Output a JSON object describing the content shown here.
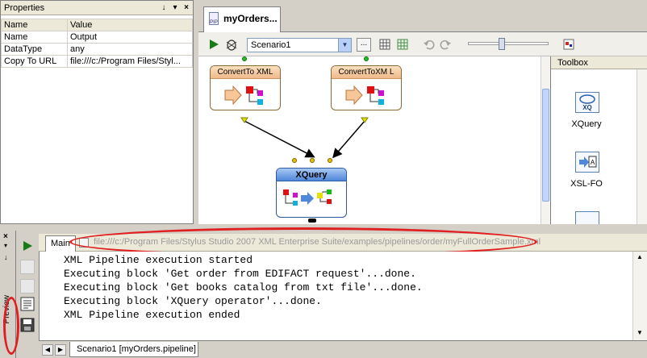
{
  "properties": {
    "title": "Properties",
    "columns": [
      "Name",
      "Value"
    ],
    "rows": [
      {
        "name": "Name",
        "value": "Output"
      },
      {
        "name": "DataType",
        "value": "any"
      },
      {
        "name": "Copy To URL",
        "value": "file:///c:/Program Files/Styl..."
      }
    ]
  },
  "editor": {
    "tab_label": "myOrders...",
    "tab_icon_text": "PIP",
    "scenario": "Scenario1",
    "browse_label": "..."
  },
  "canvas": {
    "blocks": [
      {
        "label": "ConvertTo XML"
      },
      {
        "label": "ConvertToXM L"
      },
      {
        "label": "XQuery"
      }
    ]
  },
  "toolbox": {
    "title": "Toolbox",
    "items": [
      {
        "label": "XQuery",
        "icon_text": "XQ"
      },
      {
        "label": "XSL-FO",
        "icon_text": "A"
      }
    ]
  },
  "preview": {
    "side_label": "Preview",
    "main_tab": "Main",
    "url": "file:///c:/Program Files/Stylus Studio 2007 XML Enterprise Suite/examples/pipelines/order/myFullOrderSample.xml",
    "output_lines": [
      "XML Pipeline execution started",
      "Executing block 'Get order from EDIFACT request'...done.",
      "Executing block 'Get books catalog from txt file'...done.",
      "Executing block 'XQuery operator'...done.",
      "XML Pipeline execution ended"
    ],
    "scenario_tab": "Scenario1 [myOrders.pipeline]"
  },
  "colors": {
    "highlight": "#e02020",
    "run": "#1a7a1a",
    "accent": "#4f87d9"
  }
}
